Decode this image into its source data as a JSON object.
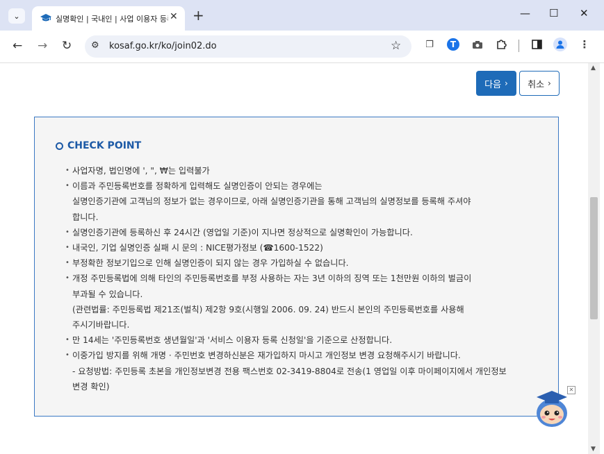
{
  "browser": {
    "tab_title": "실명확인 | 국내인 | 사업 이용자 등록",
    "url": "kosaf.go.kr/ko/join02.do"
  },
  "buttons": {
    "next_label": "다음",
    "cancel_label": "취소"
  },
  "check_point": {
    "title": "CHECK POINT",
    "items": [
      {
        "lines": [
          "사업자명, 법인명에 ', \", ₩는 입력불가"
        ]
      },
      {
        "lines": [
          "이름과 주민등록번호를 정확하게 입력해도 실명인증이 안되는 경우에는",
          "실명인증기관에 고객님의 정보가 없는 경우이므로, 아래 실명인증기관을 통해 고객님의 실명정보를 등록해 주셔야",
          "합니다."
        ]
      },
      {
        "lines": [
          "실명인증기관에 등록하신 후 24시간 (영업일 기준)이 지나면 정상적으로 실명확인이 가능합니다."
        ]
      },
      {
        "lines": [
          "내국인, 기업 실명인증 실패 시 문의 : NICE평가정보 (☎1600-1522)"
        ]
      },
      {
        "lines": [
          "부정확한 정보기입으로 인해 실명인증이 되지 않는 경우 가입하실 수 없습니다."
        ]
      },
      {
        "lines": [
          "개정 주민등록법에 의해 타인의 주민등록번호를 부정 사용하는 자는 3년 이하의 징역 또는 1천만원 이하의 벌금이",
          "부과될 수 있습니다.",
          "(관련법률: 주민등록법 제21조(벌칙) 제2항 9호(시행일 2006. 09. 24) 반드시 본인의 주민등록번호를 사용해",
          "주시기바랍니다."
        ]
      },
      {
        "lines": [
          "만 14세는 '주민등록번호 생년월일'과 '서비스 이용자 등록 신청일'을 기준으로 산정합니다."
        ]
      },
      {
        "lines": [
          "이중가입 방지를 위해 개명 · 주민번호 변경하신분은 재가입하지 마시고 개인정보 변경 요청해주시기 바랍니다.",
          "- 요청방법: 주민등록 초본을 개인정보변경 전용 팩스번호 02-3419-8804로 전송(1 영업일 이후 마이페이지에서 개인정보",
          "변경 확인)"
        ]
      }
    ]
  },
  "icons": {
    "tab_menu": "chevron-down-icon",
    "favicon": "graduation-cap-icon",
    "new_tab": "plus-icon",
    "back": "arrow-left-icon",
    "forward": "arrow-right-icon",
    "reload": "reload-icon",
    "site_info": "tune-icon",
    "bookmark": "star-icon",
    "copy": "copy-icon",
    "extension_t": "t-extension-icon",
    "camera": "camera-icon",
    "extensions": "puzzle-icon",
    "side_panel": "side-panel-icon",
    "profile": "profile-icon",
    "menu": "kebab-menu-icon",
    "mascot": "mascot-icon"
  },
  "colors": {
    "accent": "#1e6bb8",
    "title_blue": "#1d5aa6",
    "panel_bg": "#f5f5f5",
    "tabstrip_bg": "#dde3f4"
  }
}
